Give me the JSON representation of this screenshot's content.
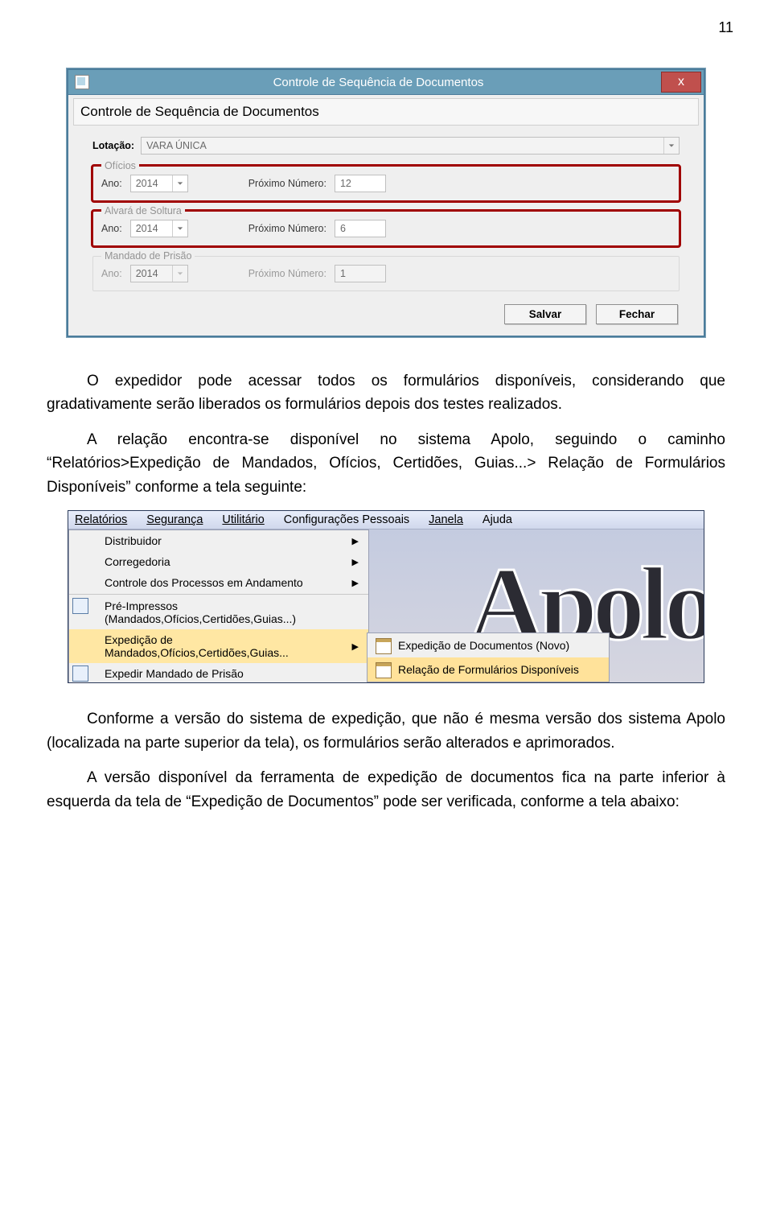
{
  "page_number": "11",
  "window1": {
    "title": "Controle de Sequência de Documentos",
    "section_title": "Controle de Sequência de Documentos",
    "close_label": "x",
    "lotacao_label": "Lotação:",
    "lotacao_value": "VARA ÚNICA",
    "groups": {
      "oficios": {
        "legend": "Ofícios",
        "ano_label": "Ano:",
        "ano_value": "2014",
        "proximo_label": "Próximo Número:",
        "proximo_value": "12"
      },
      "alvara": {
        "legend": "Alvará de Soltura",
        "ano_label": "Ano:",
        "ano_value": "2014",
        "proximo_label": "Próximo Número:",
        "proximo_value": "6"
      },
      "mandado": {
        "legend": "Mandado de Prisão",
        "ano_label": "Ano:",
        "ano_value": "2014",
        "proximo_label": "Próximo Número:",
        "proximo_value": "1"
      }
    },
    "save_label": "Salvar",
    "close_btn_label": "Fechar"
  },
  "para1": "O expedidor pode acessar todos os formulários disponíveis, considerando que gradativamente serão liberados os formulários depois dos testes realizados.",
  "para2": "A relação encontra-se disponível no sistema Apolo, seguindo o caminho “Relatórios>Expedição de Mandados, Ofícios, Certidões, Guias...> Relação de Formulários Disponíveis” conforme a tela seguinte:",
  "menu": {
    "items": {
      "relatorios": "Relatórios",
      "seguranca": "Segurança",
      "utilitario": "Utilitário",
      "config": "Configurações Pessoais",
      "janela": "Janela",
      "ajuda": "Ajuda"
    },
    "dropdown": {
      "distribuidor": "Distribuidor",
      "corregedoria": "Corregedoria",
      "controle": "Controle dos Processos em Andamento",
      "pre": "Pré-Impressos (Mandados,Ofícios,Certidões,Guias...)",
      "exped": "Expedição de Mandados,Ofícios,Certidões,Guias...",
      "expedir": "Expedir Mandado de Prisão"
    },
    "submenu": {
      "novo": "Expedição de Documentos (Novo)",
      "relacao": "Relação de Formulários Disponíveis"
    },
    "bg_text": "Apolo"
  },
  "para3": "Conforme a versão do sistema de expedição, que não é mesma versão dos sistema Apolo (localizada na parte superior da tela), os formulários serão alterados e aprimorados.",
  "para4": "A versão disponível da ferramenta de expedição de documentos fica na parte inferior à esquerda da tela de “Expedição de Documentos” pode ser verificada, conforme a tela abaixo:"
}
